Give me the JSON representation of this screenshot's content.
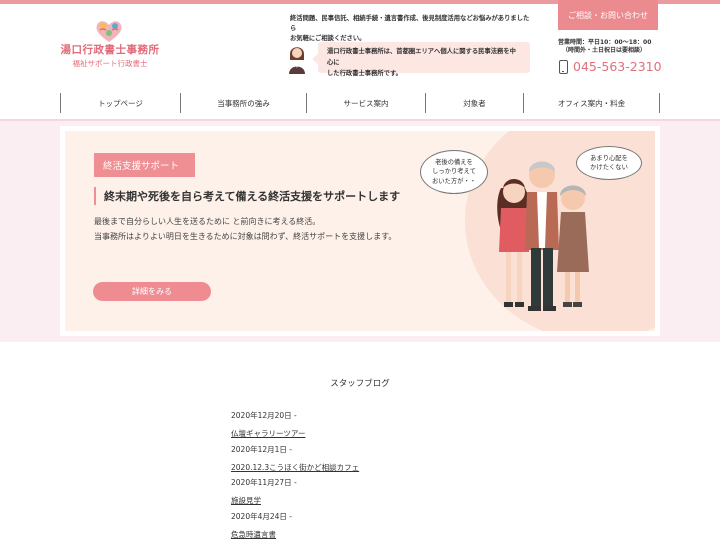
{
  "header": {
    "logo_title": "湯口行政書士事務所",
    "logo_sub": "福祉サポート行政書士",
    "intro_line1": "終活問題、民事信託、相続手続・遺言書作成、後見制度活用などお悩みがありましたら",
    "intro_line2": "お気軽にご相談ください。",
    "bubble_line1": "湯口行政書士事務所は、首都圏エリアへ個人に関する民事法務を中心に",
    "bubble_line2": "した行政書士事務所です。",
    "contact_label": "ご相談・お問い合わせ",
    "hours_line1": "営業時間：平日10：00〜18：00",
    "hours_line2": "（時間外・土日祝日は要相談）",
    "phone": "045-563-2310"
  },
  "nav": {
    "items": [
      {
        "label": "トップページ"
      },
      {
        "label": "当事務所の強み"
      },
      {
        "label": "サービス案内"
      },
      {
        "label": "対象者"
      },
      {
        "label": "オフィス案内・料金"
      }
    ]
  },
  "hero": {
    "tag": "終活支援サポート",
    "heading": "終末期や死後を自ら考えて備える終活支援をサポートします",
    "text_line1": "最後まで自分らしい人生を送るために と前向きに考える終活。",
    "text_line2": "当事務所はよりよい明日を生きるために対象は問わず、終活サポートを支援します。",
    "button": "詳細をみる",
    "speech1_line1": "老後の備えを",
    "speech1_line2": "しっかり考えて",
    "speech1_line3": "おいた方が・・",
    "speech2_line1": "あまり心配を",
    "speech2_line2": "かけたくない"
  },
  "blog": {
    "title": "スタッフブログ",
    "posts": [
      {
        "date": "2020年12月20日 -",
        "title": "仏壇ギャラリーツアー"
      },
      {
        "date": "2020年12月1日 -",
        "title": "2020.12.3こうほく街かど相談カフェ"
      },
      {
        "date": "2020年11月27日 -",
        "title": "施設見学"
      },
      {
        "date": "2020年4月24日 -",
        "title": "危急時遺言書"
      }
    ]
  },
  "colors": {
    "accent": "#eb8a8f",
    "phone": "#e0707c",
    "hero_bg": "#fbeef2",
    "hero_inner": "#fdf1ea"
  }
}
